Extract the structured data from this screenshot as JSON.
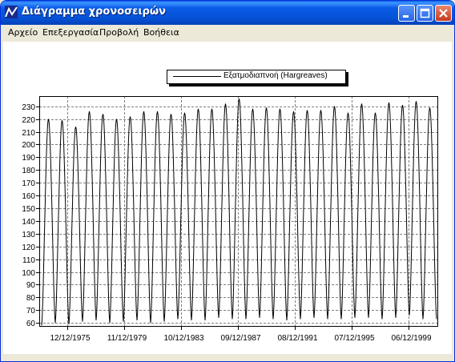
{
  "window": {
    "title": "Διάγραμμα χρονοσειρών"
  },
  "menu": {
    "items": [
      "Αρχείο",
      "Επεξεργασία",
      "Προβολή",
      "Βοήθεια"
    ]
  },
  "chart_data": {
    "type": "line",
    "legend_position": "top-center",
    "series": [
      {
        "name": "Εξατμοδιαπνοή (Hargreaves)",
        "color": "#000000",
        "annual_peaks": [
          220,
          219,
          214,
          226,
          224,
          220,
          222,
          226,
          226,
          224,
          225,
          228,
          228,
          232,
          236,
          228,
          229,
          228,
          226,
          227,
          227,
          230,
          225,
          232,
          225,
          233,
          231,
          234,
          229
        ],
        "annual_troughs": [
          58,
          60,
          59,
          61,
          62,
          60,
          61,
          62,
          60,
          61,
          63,
          62,
          62,
          64,
          63,
          63,
          64,
          63,
          62,
          63,
          64,
          63,
          63,
          64,
          64,
          63,
          64,
          66,
          63
        ]
      }
    ],
    "x_ticks": [
      "12/12/1975",
      "11/12/1979",
      "10/12/1983",
      "09/12/1987",
      "08/12/1991",
      "07/12/1995",
      "06/12/1999"
    ],
    "y_ticks": [
      60,
      70,
      80,
      90,
      100,
      110,
      120,
      130,
      140,
      150,
      160,
      170,
      180,
      190,
      200,
      210,
      220,
      230
    ],
    "ylim": [
      57,
      238
    ],
    "grid": true,
    "grid_style": "dashed"
  }
}
